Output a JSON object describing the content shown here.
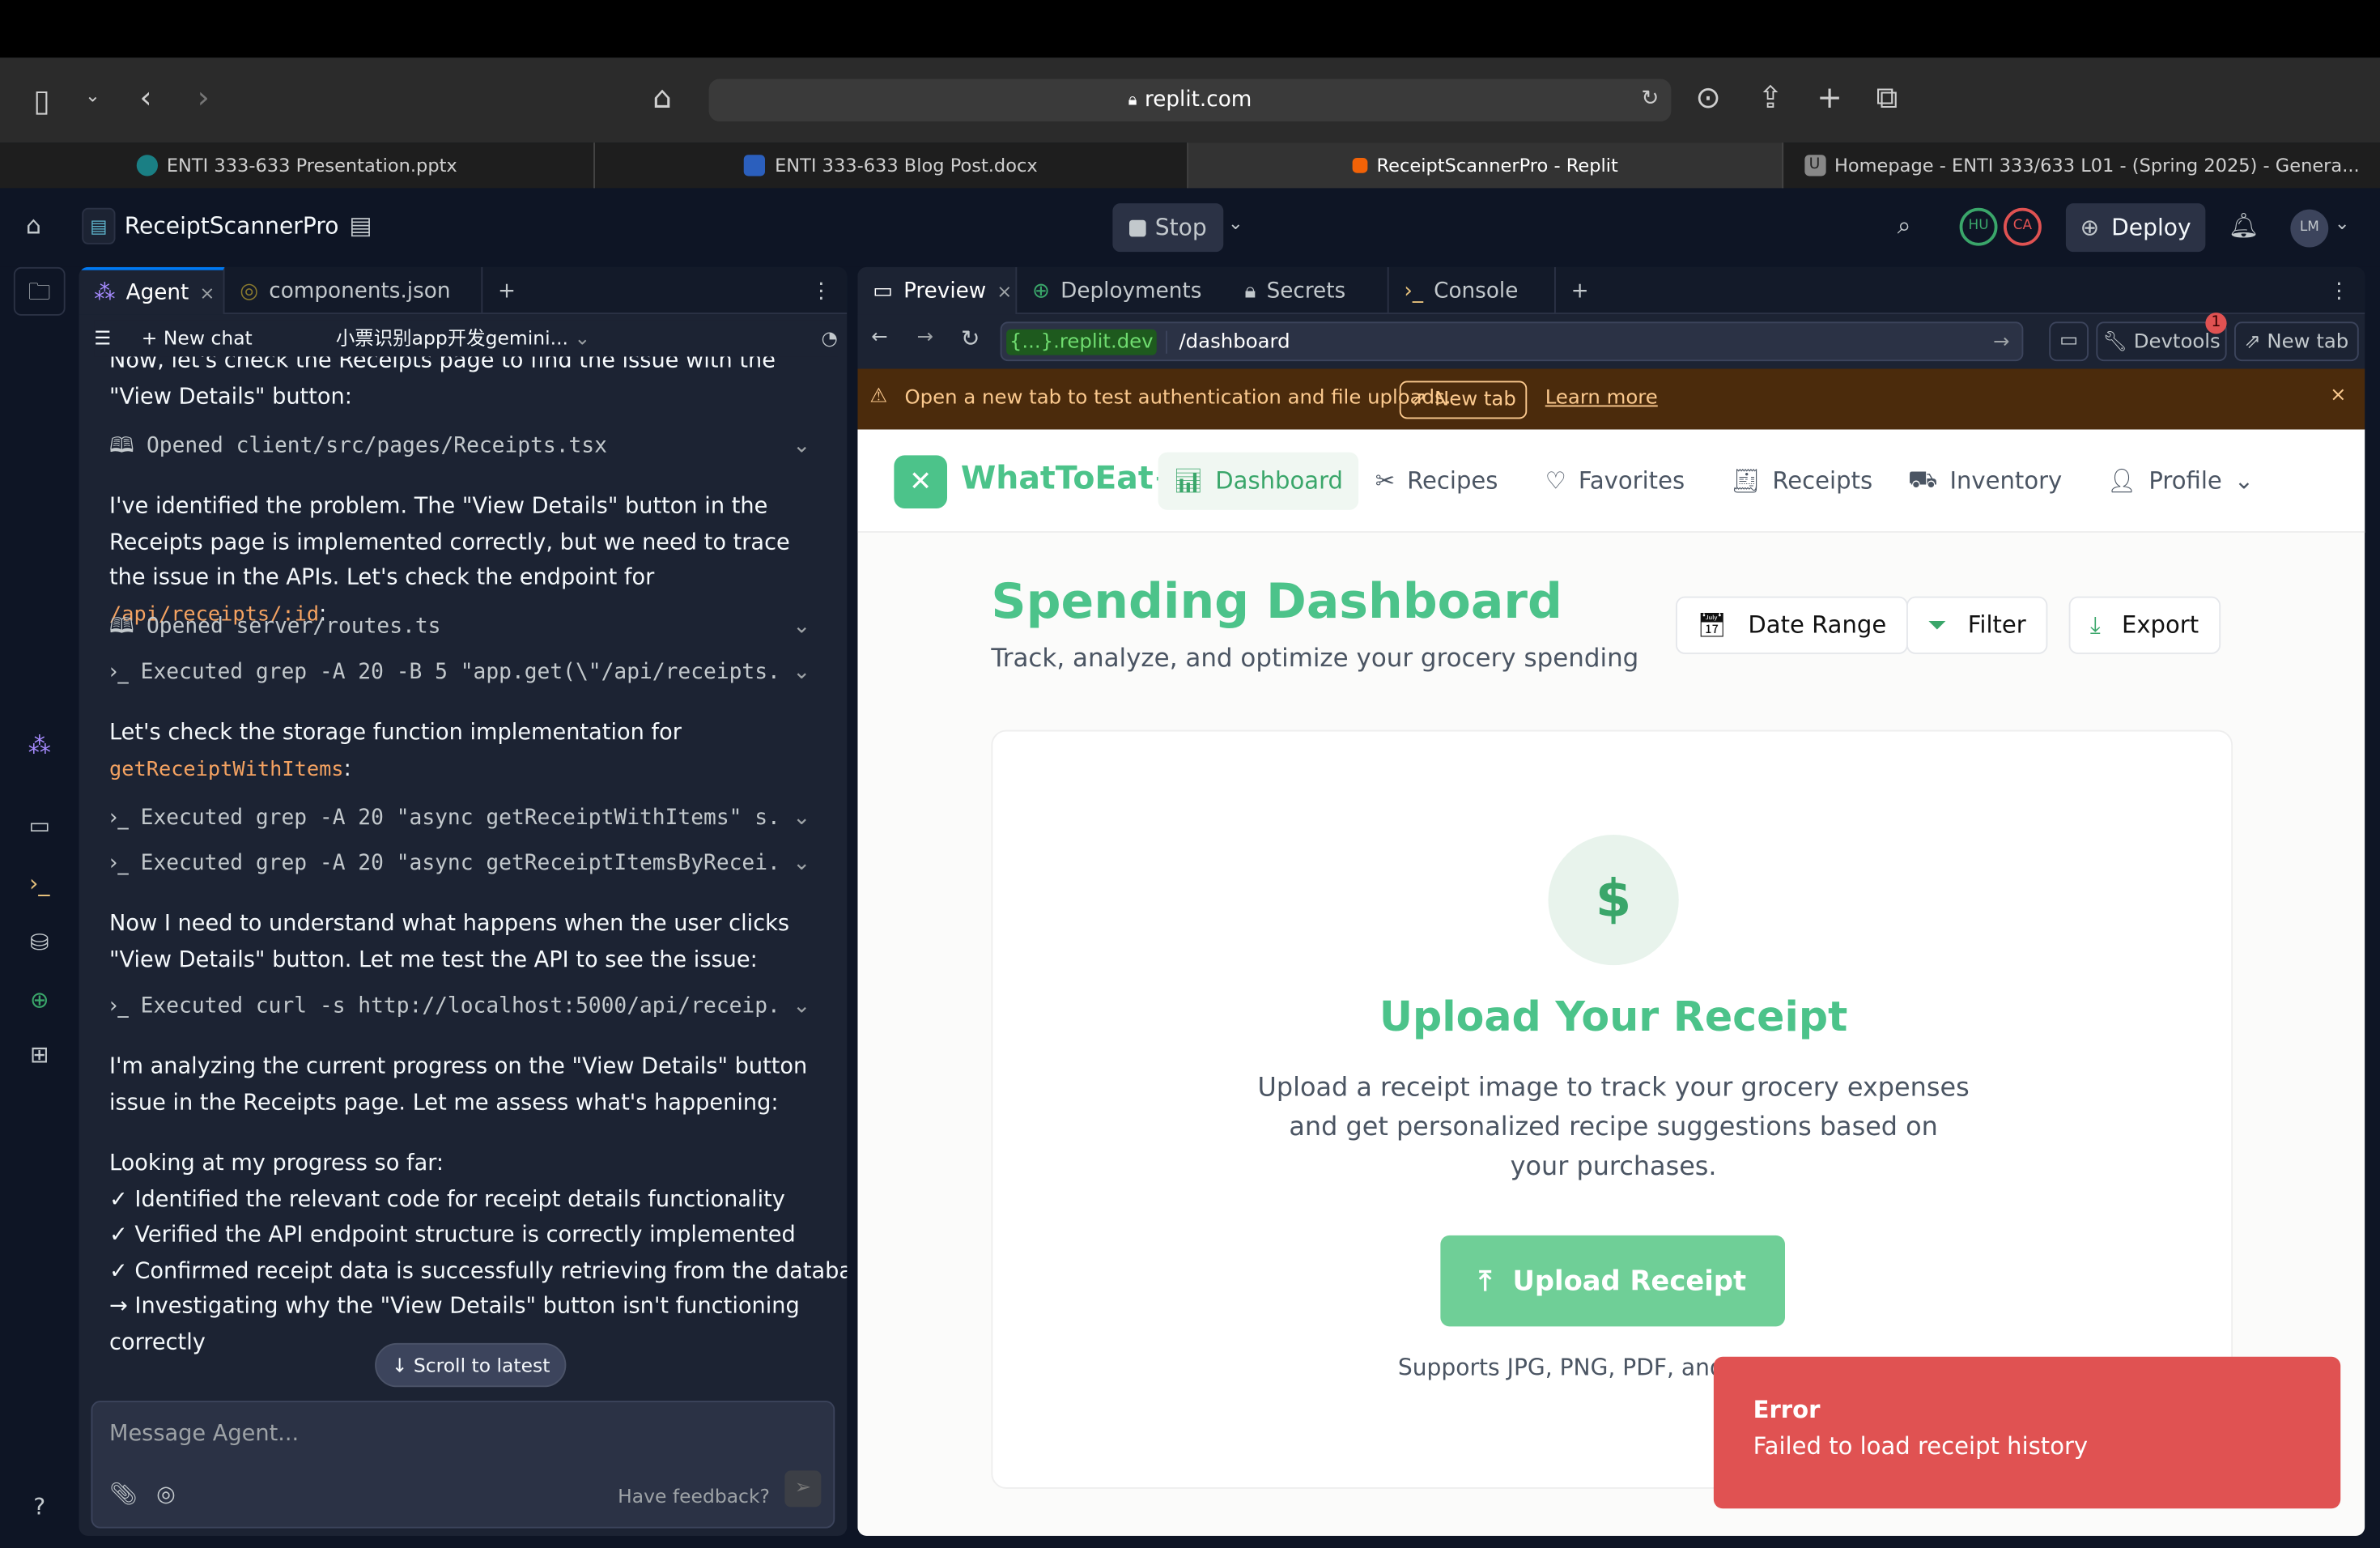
{
  "browser": {
    "url": "replit.com",
    "tabs": [
      {
        "label": "ENTI 333-633 Presentation.pptx",
        "icon": "sharepoint-icon"
      },
      {
        "label": "ENTI 333-633 Blog Post.docx",
        "icon": "word-icon"
      },
      {
        "label": "ReceiptScannerPro - Replit",
        "icon": "replit-icon",
        "active": true
      },
      {
        "label": "Homepage - ENTI 333/633 L01 - (Spring 2025) - Genera...",
        "icon": "u-icon"
      }
    ]
  },
  "header": {
    "project": "ReceiptScannerPro",
    "stop": "Stop",
    "deploy": "Deploy",
    "avatars": [
      "HU",
      "CA"
    ],
    "user": "LM"
  },
  "left": {
    "tabs": [
      "Agent",
      "components.json"
    ],
    "new_chat": "New chat",
    "chat_title": "小票识别app开发gemini...",
    "messages": {
      "m0": "Now, let's check the Receipts page to find the issue with the \"View Details\" button:",
      "a1": "Opened client/src/pages/Receipts.tsx",
      "m1": "I've identified the problem. The \"View Details\" button in the Receipts page is implemented correctly, but we need to trace the issue in the APIs. Let's check the endpoint for",
      "m1code": "/api/receipts/:id",
      "a2": "Opened server/routes.ts",
      "a3": "Executed grep -A 20 -B 5 \"app.get(\\\"/api/receipts...",
      "m2": "Let's check the storage function implementation for",
      "m2code": "getReceiptWithItems",
      "a4": "Executed grep -A 20 \"async getReceiptWithItems\" s...",
      "a5": "Executed grep -A 20 \"async getReceiptItemsByRecei...",
      "m3": "Now I need to understand what happens when the user clicks \"View Details\" button. Let me test the API to see the issue:",
      "a6": "Executed curl -s http://localhost:5000/api/receip...",
      "m4": "I'm analyzing the current progress on the \"View Details\" button issue in the Receipts page. Let me assess what's happening:",
      "m5": "Looking at my progress so far:",
      "p1": "✓ Identified the relevant code for receipt details functionality",
      "p2": "✓ Verified the API endpoint structure is correctly implemented",
      "p3": "✓ Confirmed receipt data is successfully retrieving from the database",
      "p4": "→ Investigating why the \"View Details\" button isn't functioning correctly"
    },
    "scroll_latest": "↓ Scroll to latest",
    "placeholder": "Message Agent...",
    "feedback": "Have feedback?"
  },
  "right": {
    "tabs": [
      "Preview",
      "Deployments",
      "Secrets",
      "Console"
    ],
    "domain": "{...}.replit.dev",
    "path": "/dashboard",
    "devtools": "Devtools",
    "devtools_badge": "1",
    "new_tab": "New tab",
    "banner": {
      "text": "Open a new tab to test authentication and file uploads.",
      "new_tab": "New tab",
      "learn": "Learn more"
    }
  },
  "app": {
    "brand": "WhatToEat+",
    "nav": [
      "Dashboard",
      "Recipes",
      "Favorites",
      "Receipts",
      "Inventory",
      "Profile"
    ],
    "title": "Spending Dashboard",
    "subtitle": "Track, analyze, and optimize your grocery spending",
    "actions": [
      "Date Range",
      "Filter",
      "Export"
    ],
    "upload_title": "Upload Your Receipt",
    "upload_desc": "Upload a receipt image to track your grocery expenses and get personalized recipe suggestions based on your purchases.",
    "upload_btn": "Upload Receipt",
    "supports": "Supports JPG, PNG, PDF, and",
    "accent": "#3aa66a"
  },
  "toast": {
    "title": "Error",
    "message": "Failed to load receipt history",
    "color": "#e05252"
  }
}
